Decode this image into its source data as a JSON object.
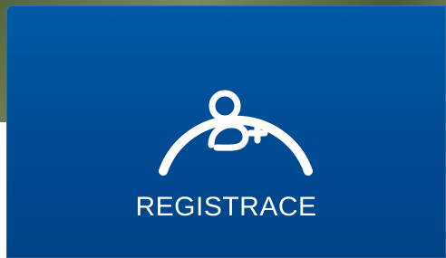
{
  "card": {
    "label": "REGISTRACE",
    "icon": "user-plus-icon",
    "accent": "#005aa6",
    "text_color": "#ffffff"
  }
}
